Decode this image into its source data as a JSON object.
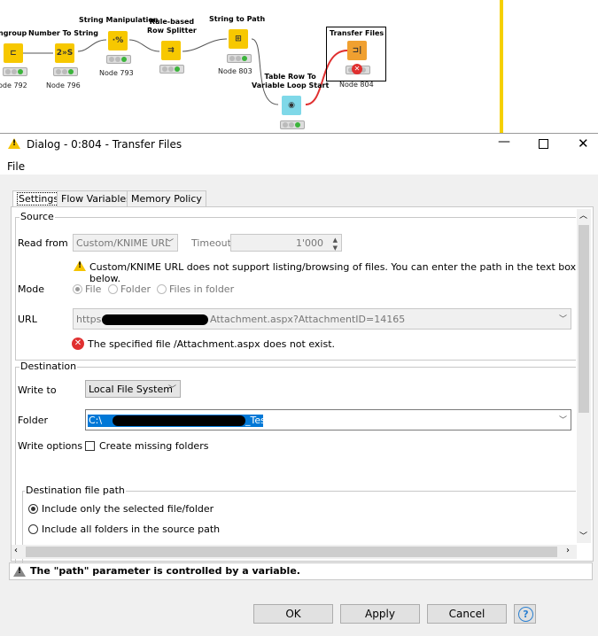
{
  "workflow": {
    "nodes": [
      {
        "label": "ngroup",
        "id": "ode 792",
        "glyph": "⊏"
      },
      {
        "label": "Number To String",
        "id": "Node 796",
        "glyph": "2»S"
      },
      {
        "label": "String Manipulation",
        "id": "Node 793",
        "glyph": "·%"
      },
      {
        "label": "Rule-based\nRow Splitter",
        "id": "",
        "glyph": "⇉"
      },
      {
        "label": "String to Path",
        "id": "Node 803",
        "glyph": "⊞"
      },
      {
        "label": "Table Row To\nVariable Loop Start",
        "id": "",
        "glyph": "◉"
      },
      {
        "label": "Transfer Files",
        "id": "Node 804",
        "glyph": "⊐|"
      }
    ]
  },
  "dialog": {
    "title": "Dialog - 0:804 - Transfer Files",
    "menu": [
      "File"
    ],
    "tabs": [
      "Settings",
      "Flow Variables",
      "Memory Policy"
    ],
    "source": {
      "legend": "Source",
      "read_from_label": "Read from",
      "read_from_value": "Custom/KNIME URL",
      "timeout_label": "Timeout",
      "timeout_value": "1'000",
      "warning": "Custom/KNIME URL does not support listing/browsing of files. You can enter the path in the text box below.",
      "mode_label": "Mode",
      "modes": [
        "File",
        "Folder",
        "Files in folder"
      ],
      "url_label": "URL",
      "url_prefix": "https:",
      "url_suffix": "Attachment.aspx?AttachmentID=14165",
      "error": "The specified file /Attachment.aspx does not exist."
    },
    "destination": {
      "legend": "Destination",
      "write_to_label": "Write to",
      "write_to_value": "Local File System",
      "folder_label": "Folder",
      "folder_prefix": "C:\\",
      "folder_suffix": "_Test",
      "write_options_label": "Write options",
      "create_missing": "Create missing folders",
      "dest_path_legend": "Destination file path",
      "dest_options": [
        "Include only the selected file/folder",
        "Include all folders in the source path"
      ]
    },
    "status": "The \"path\" parameter is controlled by a variable.",
    "buttons": {
      "ok": "OK",
      "apply": "Apply",
      "cancel": "Cancel",
      "help": "?"
    }
  }
}
